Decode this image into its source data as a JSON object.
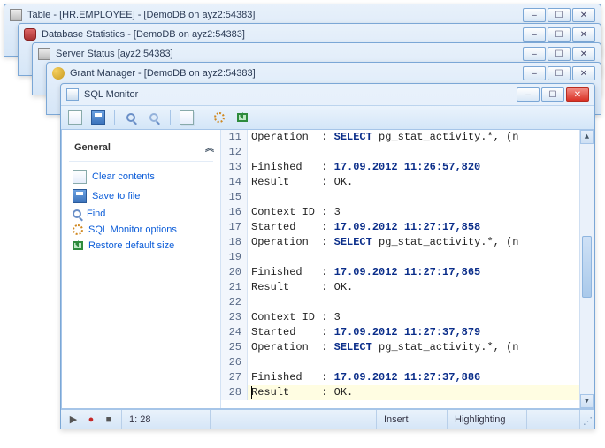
{
  "stacked_windows": [
    {
      "title": "Table - [HR.EMPLOYEE] - [DemoDB on ayz2:54383]",
      "icon": "table-icon"
    },
    {
      "title": "Database Statistics - [DemoDB on ayz2:54383]",
      "icon": "db-stats-icon"
    },
    {
      "title": "Server Status [ayz2:54383]",
      "icon": "server-status-icon"
    },
    {
      "title": "Grant Manager - [DemoDB on ayz2:54383]",
      "icon": "grant-manager-icon"
    }
  ],
  "main_window": {
    "title": "SQL Monitor",
    "toolbar": [
      {
        "name": "clear-button",
        "icon": "doc-icon"
      },
      {
        "name": "save-button",
        "icon": "save-icon"
      },
      {
        "name": "find-button",
        "icon": "find-icon"
      },
      {
        "name": "find-next-button",
        "icon": "find-next-icon"
      },
      {
        "name": "copy-button",
        "icon": "copy-icon"
      },
      {
        "name": "options-button",
        "icon": "gear-icon"
      },
      {
        "name": "restore-button",
        "icon": "restore-icon"
      }
    ]
  },
  "sidebar": {
    "header": "General",
    "items": [
      {
        "label": "Clear contents",
        "icon": "clear-icon",
        "name": "sidebar-clear-contents"
      },
      {
        "label": "Save to file",
        "icon": "save-icon",
        "name": "sidebar-save-to-file"
      },
      {
        "label": "Find",
        "icon": "find-icon",
        "name": "sidebar-find"
      },
      {
        "label": "SQL Monitor options",
        "icon": "gear-icon",
        "name": "sidebar-options"
      },
      {
        "label": "Restore default size",
        "icon": "restore-icon",
        "name": "sidebar-restore-size"
      }
    ]
  },
  "log_lines": [
    {
      "n": 11,
      "label": "Operation  : ",
      "kw": "SELECT",
      "rest": " pg_stat_activity.*, (n"
    },
    {
      "n": 12,
      "label": "",
      "rest": ""
    },
    {
      "n": 13,
      "label": "Finished   : ",
      "ts": "17.09.2012 11:26:57,820"
    },
    {
      "n": 14,
      "label": "Result     : ",
      "rest": "OK."
    },
    {
      "n": 15,
      "label": "",
      "rest": ""
    },
    {
      "n": 16,
      "label": "Context ID : ",
      "rest": "3"
    },
    {
      "n": 17,
      "label": "Started    : ",
      "ts": "17.09.2012 11:27:17,858"
    },
    {
      "n": 18,
      "label": "Operation  : ",
      "kw": "SELECT",
      "rest": " pg_stat_activity.*, (n"
    },
    {
      "n": 19,
      "label": "",
      "rest": ""
    },
    {
      "n": 20,
      "label": "Finished   : ",
      "ts": "17.09.2012 11:27:17,865"
    },
    {
      "n": 21,
      "label": "Result     : ",
      "rest": "OK."
    },
    {
      "n": 22,
      "label": "",
      "rest": ""
    },
    {
      "n": 23,
      "label": "Context ID : ",
      "rest": "3"
    },
    {
      "n": 24,
      "label": "Started    : ",
      "ts": "17.09.2012 11:27:37,879"
    },
    {
      "n": 25,
      "label": "Operation  : ",
      "kw": "SELECT",
      "rest": " pg_stat_activity.*, (n"
    },
    {
      "n": 26,
      "label": "",
      "rest": ""
    },
    {
      "n": 27,
      "label": "Finished   : ",
      "ts": "17.09.2012 11:27:37,886"
    },
    {
      "n": 28,
      "label": "Result     : ",
      "rest": "OK.",
      "hl": true,
      "caret": true
    }
  ],
  "statusbar": {
    "position": "1: 28",
    "mode": "Insert",
    "highlighting": "Highlighting"
  }
}
